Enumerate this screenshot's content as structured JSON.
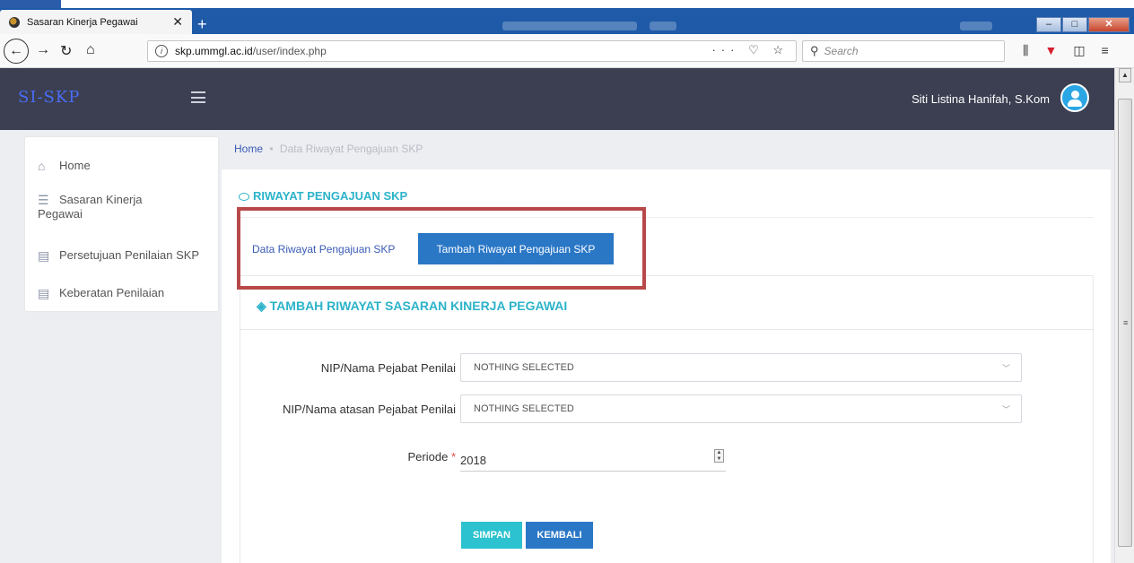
{
  "browser": {
    "tab_title": "Sasaran Kinerja Pegawai",
    "tab_close": "✕",
    "new_tab": "+",
    "url_domain": "skp.ummgl.ac.id",
    "url_path": "/user/index.php",
    "url_actions": "··· ♡ ☆",
    "search_placeholder": "Search"
  },
  "app": {
    "brand": "SI-SKP",
    "user_name": "Siti Listina Hanifah, S.Kom"
  },
  "sidebar": {
    "items": [
      {
        "label": "Home"
      },
      {
        "label_line1": "Sasaran Kinerja",
        "label_line2": "Pegawai"
      },
      {
        "label": "Persetujuan Penilaian SKP"
      },
      {
        "label": "Keberatan Penilaian"
      }
    ]
  },
  "breadcrumb": {
    "home": "Home",
    "current": "Data Riwayat Pengajuan SKP"
  },
  "card": {
    "title": "RIWAYAT PENGAJUAN SKP",
    "tabs": [
      {
        "label": "Data Riwayat Pengajuan SKP",
        "active": false
      },
      {
        "label": "Tambah Riwayat Pengajuan SKP",
        "active": true
      }
    ]
  },
  "form": {
    "title": "TAMBAH RIWAYAT SASARAN KINERJA PEGAWAI",
    "pejabat_label": "NIP/Nama Pejabat Penilai",
    "pejabat_value": "NOTHING SELECTED",
    "atasan_label": "NIP/Nama atasan Pejabat Penilai",
    "atasan_value": "NOTHING SELECTED",
    "periode_label": "Periode",
    "periode_required": "*",
    "periode_value": "2018",
    "save_label": "SIMPAN",
    "back_label": "KEMBALI"
  },
  "colors": {
    "header_bg": "#3b3f51",
    "accent_teal": "#2cb3c9",
    "primary_blue": "#2a77c6",
    "highlight_red": "#b8484a"
  }
}
